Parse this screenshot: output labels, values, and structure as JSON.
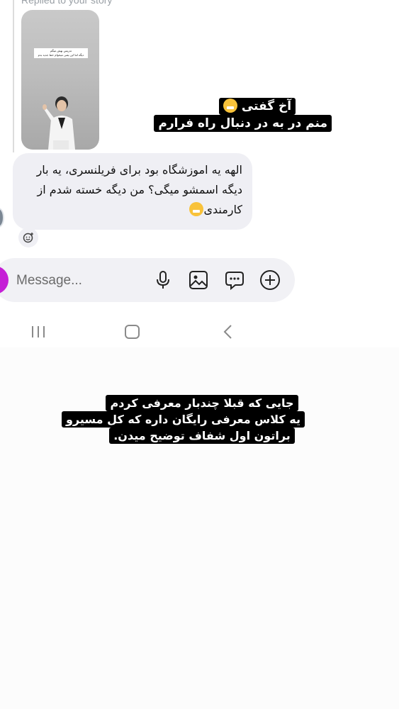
{
  "reply": {
    "label": "Replied to your story"
  },
  "story": {
    "caption_line1": "تدریس بهش میگم",
    "caption_line2": "دیگه اما این یعنی میخوام خط جدید بدم"
  },
  "overlay_top": {
    "line1": "آخ گفتی",
    "line2": "منم در به در دنبال راه فرارم"
  },
  "message": {
    "line1": "الهه یه اموزشگاه بود برای فریلنسری، یه بار",
    "line2": "دیگه اسمشو میگی؟ من دیگه خسته شدم از",
    "line3": "کارمندی"
  },
  "composer": {
    "placeholder": "Message...",
    "icons": [
      "microphone-icon",
      "gallery-icon",
      "sticker-icon",
      "plus-icon"
    ]
  },
  "overlay_bottom": {
    "line1": "جایی که قبلا چندبار معرفی کردم",
    "line2": "یه کلاس معرفی رایگان داره که کل مسیرو",
    "line3": "براتون اول شفاف توضیح میدن."
  },
  "colors": {
    "bubble": "#efeff4",
    "camera_accent": "#c51fd6",
    "sticker_bg": "#000000"
  }
}
